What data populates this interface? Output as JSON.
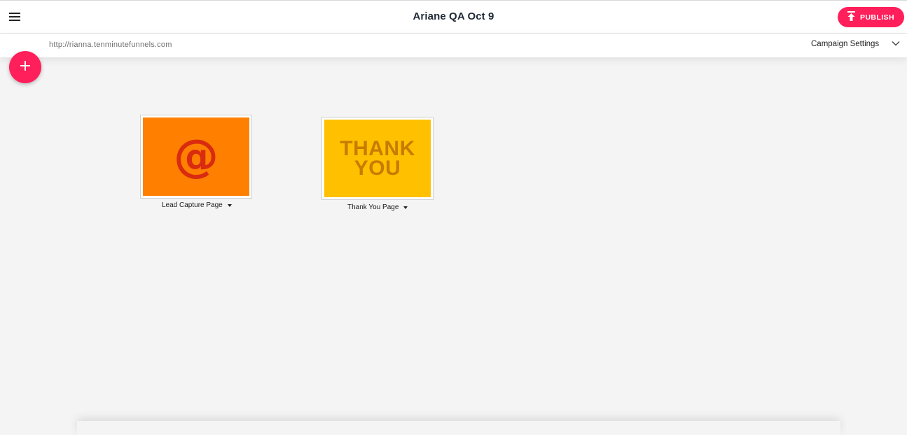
{
  "header": {
    "title": "Ariane QA Oct 9",
    "publish_label": "PUBLISH",
    "menu_icon": "menu-icon",
    "publish_icon": "upload-icon"
  },
  "subbar": {
    "url": "http://rianna.tenminutefunnels.com",
    "settings_label": "Campaign Settings",
    "settings_icon": "chevron-down-icon"
  },
  "fab": {
    "icon": "plus-icon"
  },
  "pages": [
    {
      "label": "Lead Capture Page",
      "thumbnail_text": "@",
      "thumbnail_color": "#ff8000"
    },
    {
      "label": "Thank You Page",
      "thumbnail_text_line1": "THANK",
      "thumbnail_text_line2": "YOU",
      "thumbnail_color": "#ffc000"
    }
  ],
  "colors": {
    "accent": "#ff1f5a",
    "background": "#f4f4f4"
  }
}
